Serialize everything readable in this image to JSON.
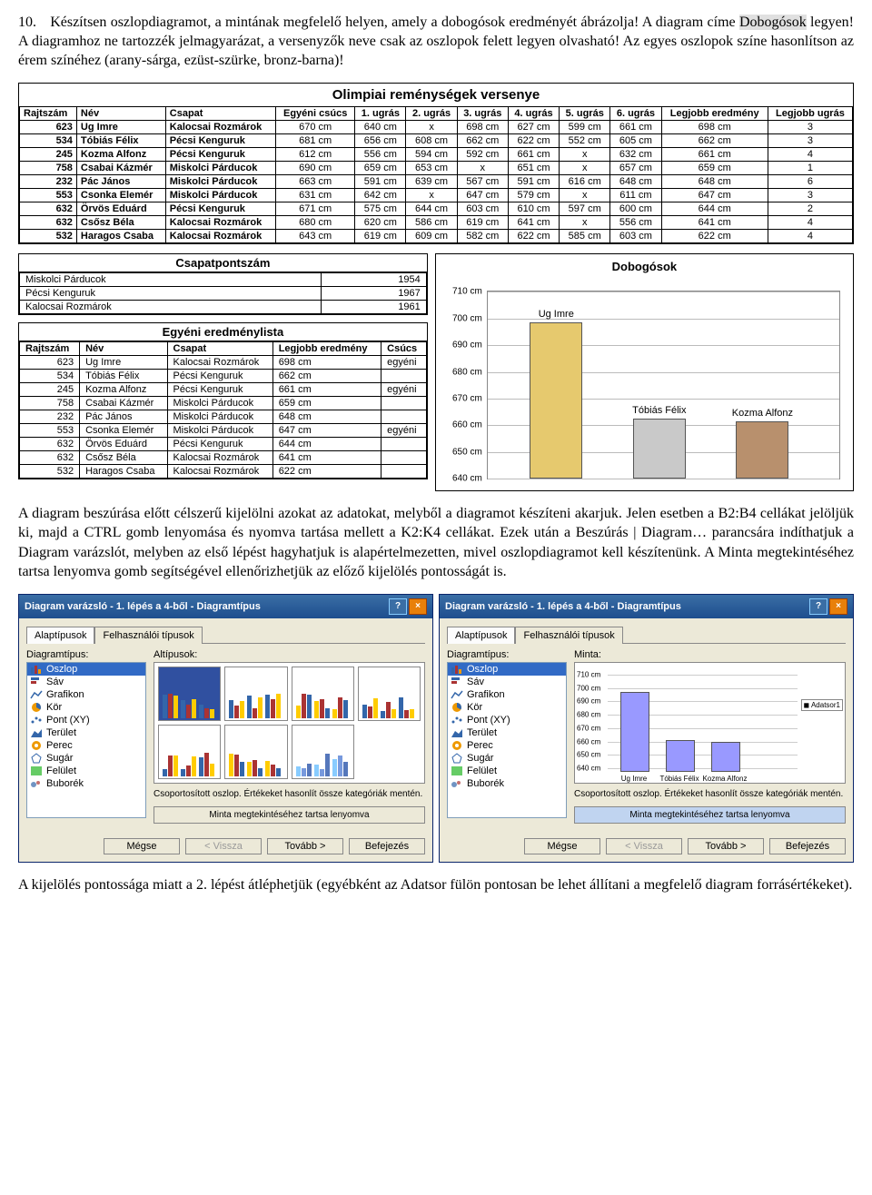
{
  "task": {
    "number": "10.",
    "text_a": "Készítsen oszlopdiagramot, a mintának megfelelő helyen, amely a dobogósok eredményét ábrázolja! A diagram címe ",
    "title_hl": "Dobogósok",
    "text_b": " legyen! A diagramhoz ne tartozzék jelmagyarázat, a versenyzők neve csak az oszlopok felett legyen olvasható! Az egyes oszlopok színe hasonlítson az érem színéhez (arany-sárga, ezüst-szürke, bronz-barna)!"
  },
  "sheet": {
    "title": "Olimpiai reménységek versenye",
    "headers": [
      "Rajtszám",
      "Név",
      "Csapat",
      "Egyéni csúcs",
      "1. ugrás",
      "2. ugrás",
      "3. ugrás",
      "4. ugrás",
      "5. ugrás",
      "6. ugrás",
      "Legjobb eredmény",
      "Legjobb ugrás"
    ],
    "rows": [
      [
        "623",
        "Ug Imre",
        "Kalocsai Rozmárok",
        "670 cm",
        "640 cm",
        "x",
        "698 cm",
        "627 cm",
        "599 cm",
        "661 cm",
        "698 cm",
        "3"
      ],
      [
        "534",
        "Tóbiás Félix",
        "Pécsi Kenguruk",
        "681 cm",
        "656 cm",
        "608 cm",
        "662 cm",
        "622 cm",
        "552 cm",
        "605 cm",
        "662 cm",
        "3"
      ],
      [
        "245",
        "Kozma Alfonz",
        "Pécsi Kenguruk",
        "612 cm",
        "556 cm",
        "594 cm",
        "592 cm",
        "661 cm",
        "x",
        "632 cm",
        "661 cm",
        "4"
      ],
      [
        "758",
        "Csabai Kázmér",
        "Miskolci Párducok",
        "690 cm",
        "659 cm",
        "653 cm",
        "x",
        "651 cm",
        "x",
        "657 cm",
        "659 cm",
        "1"
      ],
      [
        "232",
        "Pác János",
        "Miskolci Párducok",
        "663 cm",
        "591 cm",
        "639 cm",
        "567 cm",
        "591 cm",
        "616 cm",
        "648 cm",
        "648 cm",
        "6"
      ],
      [
        "553",
        "Csonka Elemér",
        "Miskolci Párducok",
        "631 cm",
        "642 cm",
        "x",
        "647 cm",
        "579 cm",
        "x",
        "611 cm",
        "647 cm",
        "3"
      ],
      [
        "632",
        "Örvös Eduárd",
        "Pécsi Kenguruk",
        "671 cm",
        "575 cm",
        "644 cm",
        "603 cm",
        "610 cm",
        "597 cm",
        "600 cm",
        "644 cm",
        "2"
      ],
      [
        "632",
        "Csősz Béla",
        "Kalocsai Rozmárok",
        "680 cm",
        "620 cm",
        "586 cm",
        "619 cm",
        "641 cm",
        "x",
        "556 cm",
        "641 cm",
        "4"
      ],
      [
        "532",
        "Haragos Csaba",
        "Kalocsai Rozmárok",
        "643 cm",
        "619 cm",
        "609 cm",
        "582 cm",
        "622 cm",
        "585 cm",
        "603 cm",
        "622 cm",
        "4"
      ]
    ]
  },
  "csapat": {
    "title": "Csapatpontszám",
    "rows": [
      [
        "Miskolci Párducok",
        "1954"
      ],
      [
        "Pécsi Kenguruk",
        "1967"
      ],
      [
        "Kalocsai Rozmárok",
        "1961"
      ]
    ]
  },
  "egyeni": {
    "title": "Egyéni eredménylista",
    "headers": [
      "Rajtszám",
      "Név",
      "Csapat",
      "Legjobb eredmény",
      "Csúcs"
    ],
    "rows": [
      [
        "623",
        "Ug Imre",
        "Kalocsai Rozmárok",
        "698 cm",
        "egyéni"
      ],
      [
        "534",
        "Tóbiás Félix",
        "Pécsi Kenguruk",
        "662 cm",
        ""
      ],
      [
        "245",
        "Kozma Alfonz",
        "Pécsi Kenguruk",
        "661 cm",
        "egyéni"
      ],
      [
        "758",
        "Csabai Kázmér",
        "Miskolci Párducok",
        "659 cm",
        ""
      ],
      [
        "232",
        "Pác János",
        "Miskolci Párducok",
        "648 cm",
        ""
      ],
      [
        "553",
        "Csonka Elemér",
        "Miskolci Párducok",
        "647 cm",
        "egyéni"
      ],
      [
        "632",
        "Örvös Eduárd",
        "Pécsi Kenguruk",
        "644 cm",
        ""
      ],
      [
        "632",
        "Csősz Béla",
        "Kalocsai Rozmárok",
        "641 cm",
        ""
      ],
      [
        "532",
        "Haragos Csaba",
        "Kalocsai Rozmárok",
        "622 cm",
        ""
      ]
    ]
  },
  "chart_data": {
    "type": "bar",
    "title": "Dobogósok",
    "categories": [
      "Ug Imre",
      "Tóbiás Félix",
      "Kozma Alfonz"
    ],
    "values": [
      698,
      662,
      661
    ],
    "ylim": [
      640,
      710
    ],
    "yticks": [
      640,
      650,
      660,
      670,
      680,
      690,
      700,
      710
    ],
    "yunit": " cm",
    "colors": [
      "#e6c96e",
      "#c9c9c9",
      "#b8906d"
    ]
  },
  "para1": "A diagram beszúrása előtt célszerű kijelölni azokat az adatokat, melyből a diagramot készíteni akarjuk. Jelen esetben a B2:B4 cellákat jelöljük ki, majd a CTRL gomb lenyomása és nyomva tartása mellett a K2:K4 cellákat. Ezek után a Beszúrás | Diagram… parancsára indíthatjuk a Diagram varázslót, melyben az első lépést hagyhatjuk is alapértelmezetten, mivel oszlopdiagramot kell készítenünk. A Minta megtekintéséhez tartsa lenyomva gomb segítségével ellenőrizhetjük az előző kijelölés pontosságát is.",
  "wizard": {
    "title": "Diagram varázsló - 1. lépés a 4-ből - Diagramtípus",
    "tabs": [
      "Alaptípusok",
      "Felhasználói típusok"
    ],
    "label_types": "Diagramtípus:",
    "label_sub": "Altípusok:",
    "label_preview": "Minta:",
    "types": [
      "Oszlop",
      "Sáv",
      "Grafikon",
      "Kör",
      "Pont (XY)",
      "Terület",
      "Perec",
      "Sugár",
      "Felület",
      "Buborék"
    ],
    "desc": "Csoportosított oszlop. Értékeket hasonlít össze kategóriák mentén.",
    "hold_btn": "Minta megtekintéséhez tartsa lenyomva",
    "buttons": {
      "cancel": "Mégse",
      "back": "< Vissza",
      "next": "Tovább >",
      "finish": "Befejezés"
    },
    "legend": "Adatsor1",
    "preview_yticks": [
      "640 cm",
      "650 cm",
      "660 cm",
      "670 cm",
      "680 cm",
      "690 cm",
      "700 cm",
      "710 cm"
    ],
    "preview_cats": [
      "Ug Imre",
      "Tóbiás Félix",
      "Kozma Alfonz"
    ]
  },
  "para2": "A kijelölés pontossága miatt a 2. lépést átléphetjük (egyébként az Adatsor fülön pontosan be lehet állítani a megfelelő diagram forrásértékeket)."
}
